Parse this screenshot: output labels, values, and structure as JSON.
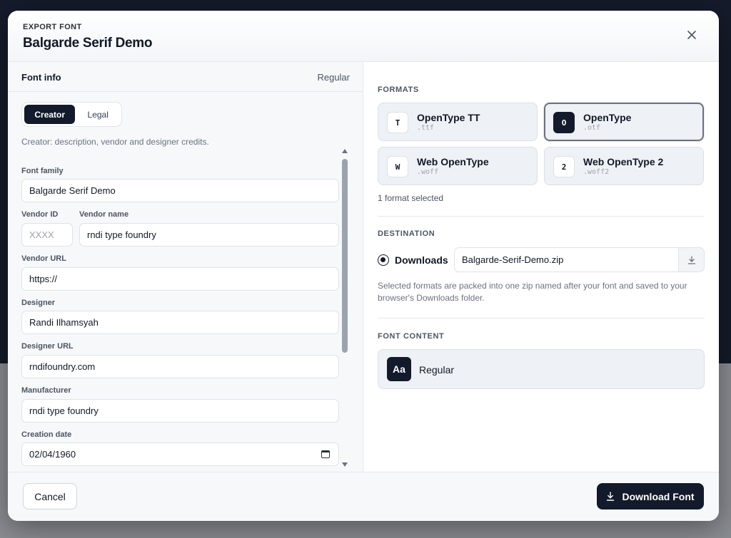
{
  "header": {
    "eyebrow": "EXPORT FONT",
    "title": "Balgarde Serif Demo"
  },
  "font_info": {
    "heading": "Font info",
    "style": "Regular",
    "tabs": [
      {
        "label": "Creator",
        "active": true
      },
      {
        "label": "Legal",
        "active": false
      }
    ],
    "description": "Creator: description, vendor and designer credits.",
    "fields": {
      "font_family": {
        "label": "Font family",
        "value": "Balgarde Serif Demo"
      },
      "vendor_id": {
        "label": "Vendor ID",
        "value": "",
        "placeholder": "XXXX"
      },
      "vendor_name": {
        "label": "Vendor name",
        "value": "rndi type foundry"
      },
      "vendor_url": {
        "label": "Vendor URL",
        "value": "https://"
      },
      "designer": {
        "label": "Designer",
        "value": "Randi Ilhamsyah"
      },
      "designer_url": {
        "label": "Designer URL",
        "value": "rndifoundry.com"
      },
      "manufacturer": {
        "label": "Manufacturer",
        "value": "rndi type foundry"
      },
      "creation_date": {
        "label": "Creation date",
        "value": "02/04/1960"
      }
    }
  },
  "formats": {
    "heading": "FORMATS",
    "items": [
      {
        "badge": "T",
        "name": "OpenType TT",
        "ext": ".ttf",
        "selected": false
      },
      {
        "badge": "O",
        "name": "OpenType",
        "ext": ".otf",
        "selected": true
      },
      {
        "badge": "W",
        "name": "Web OpenType",
        "ext": ".woff",
        "selected": false
      },
      {
        "badge": "2",
        "name": "Web OpenType 2",
        "ext": ".woff2",
        "selected": false
      }
    ],
    "count_text": "1 format selected"
  },
  "destination": {
    "heading": "DESTINATION",
    "option_label": "Downloads",
    "filename": "Balgarde-Serif-Demo.zip",
    "note": "Selected formats are packed into one zip named after your font and saved to your browser's Downloads folder."
  },
  "font_content": {
    "heading": "FONT CONTENT",
    "badge": "Aa",
    "style": "Regular"
  },
  "footer": {
    "cancel_label": "Cancel",
    "download_label": "Download Font"
  },
  "colors": {
    "primary": "#121a2b",
    "card_bg": "#eef1f5",
    "muted_text": "#6b7280"
  },
  "icons": {
    "close": "close-icon",
    "download": "download-icon",
    "calendar": "calendar-icon"
  }
}
